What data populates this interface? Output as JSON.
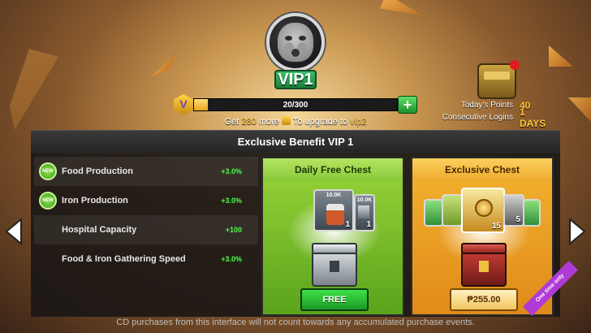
{
  "vip": {
    "badge_label": "VIP1",
    "progress_text": "20/300",
    "progress_fraction": 0.067
  },
  "upgrade": {
    "prefix": "Get",
    "amount": "280",
    "middle": "more",
    "suffix": "To upgrade to",
    "target": "vip2"
  },
  "stats": {
    "points_label": "Today's Points",
    "points_value": "40",
    "logins_label": "Consecutive Logins",
    "logins_value": "1 DAYS"
  },
  "panel": {
    "title": "Exclusive Benefit  VIP 1"
  },
  "benefits": [
    {
      "name": "Food Production",
      "value": "+3.0%",
      "is_new": true,
      "new_label": "NEW"
    },
    {
      "name": "Iron Production",
      "value": "+3.0%",
      "is_new": true,
      "new_label": "NEW"
    },
    {
      "name": "Hospital Capacity",
      "value": "+100",
      "is_new": false
    },
    {
      "name": "Food & Iron Gathering Speed",
      "value": "+3.0%",
      "is_new": false
    }
  ],
  "daily_chest": {
    "title": "Daily Free Chest",
    "items": [
      {
        "label": "10.0K",
        "count": "1"
      },
      {
        "label": "10.0K",
        "count": "1"
      }
    ],
    "button": "FREE"
  },
  "exclusive_chest": {
    "title": "Exclusive Chest",
    "featured_count": "15",
    "side_count": "5",
    "button": "₱255.00",
    "tag": "One time only"
  },
  "footer_note": "CD purchases from this interface will not count towards any accumulated purchase events.",
  "colors": {
    "accent_gold": "#ffc83a",
    "green_value": "#4bff4b",
    "new_badge": "#5cbf2a"
  },
  "icons": [
    "monkey-face-icon",
    "v-coin-icon",
    "plus-icon",
    "treasure-box-icon",
    "new-badge-icon",
    "canned-food-icon",
    "iron-ingot-icon",
    "iron-chest-icon",
    "gold-medal-icon",
    "red-chest-icon",
    "left-arrow-icon",
    "right-arrow-icon"
  ]
}
